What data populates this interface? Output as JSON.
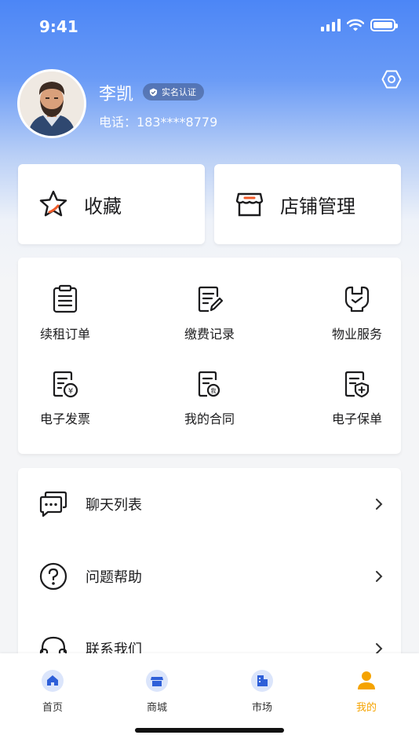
{
  "status_bar": {
    "time": "9:41",
    "icons": [
      "signal-icon",
      "wifi-icon",
      "battery-icon"
    ]
  },
  "profile": {
    "name": "李凯",
    "badge": "实名认证",
    "phone_label": "电话：",
    "phone": "183****8779",
    "settings_icon": "settings-icon"
  },
  "quick_actions": [
    {
      "label": "收藏",
      "icon": "star-icon"
    },
    {
      "label": "店铺管理",
      "icon": "store-icon"
    }
  ],
  "services": [
    {
      "label": "续租订单",
      "icon": "clipboard-icon"
    },
    {
      "label": "缴费记录",
      "icon": "edit-document-icon"
    },
    {
      "label": "物业服务",
      "icon": "tools-icon"
    },
    {
      "label": "电子发票",
      "icon": "invoice-icon"
    },
    {
      "label": "我的合同",
      "icon": "contract-icon"
    },
    {
      "label": "电子保单",
      "icon": "policy-icon"
    }
  ],
  "menu": [
    {
      "label": "聊天列表",
      "icon": "chat-icon"
    },
    {
      "label": "问题帮助",
      "icon": "help-icon"
    },
    {
      "label": "联系我们",
      "icon": "headset-icon"
    }
  ],
  "tabs": [
    {
      "label": "首页",
      "icon": "home-icon"
    },
    {
      "label": "商城",
      "icon": "shop-icon"
    },
    {
      "label": "市场",
      "icon": "building-icon"
    },
    {
      "label": "我的",
      "icon": "user-icon",
      "active": true
    }
  ],
  "colors": {
    "primary": "#4c86f6",
    "active_tab": "#f5a300",
    "accent_red": "#f05a28"
  }
}
